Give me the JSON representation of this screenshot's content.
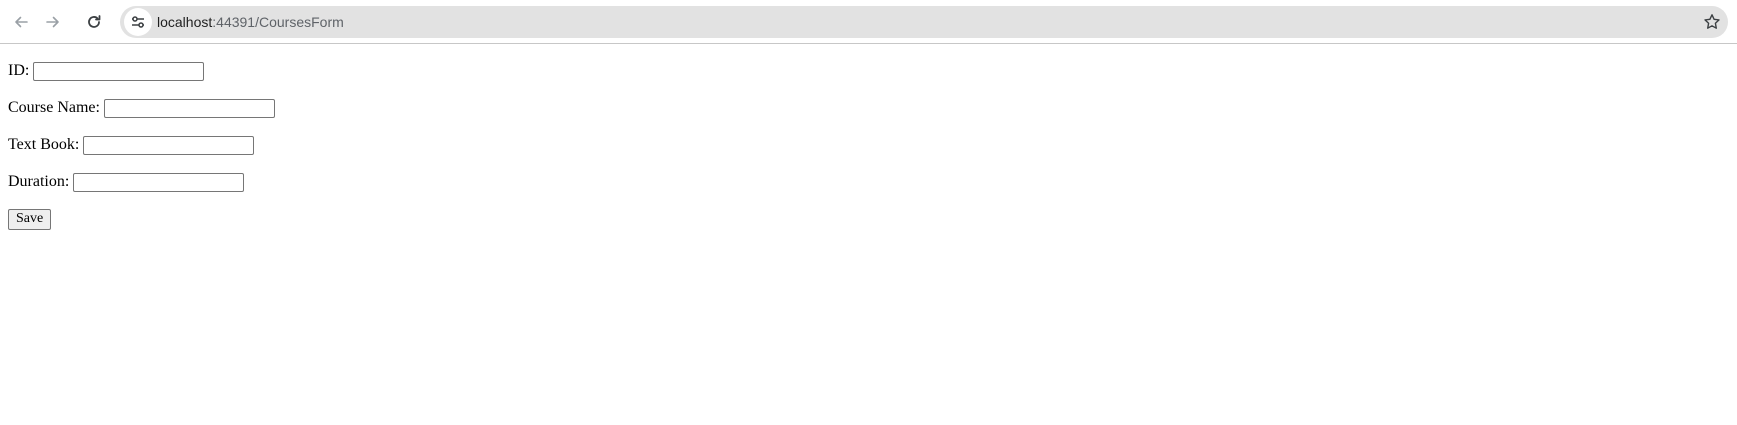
{
  "browser": {
    "url_host": "localhost",
    "url_path": ":44391/CoursesForm"
  },
  "form": {
    "fields": [
      {
        "label": "ID:",
        "value": ""
      },
      {
        "label": "Course Name:",
        "value": ""
      },
      {
        "label": "Text Book:",
        "value": ""
      },
      {
        "label": "Duration:",
        "value": ""
      }
    ],
    "save_label": "Save"
  }
}
